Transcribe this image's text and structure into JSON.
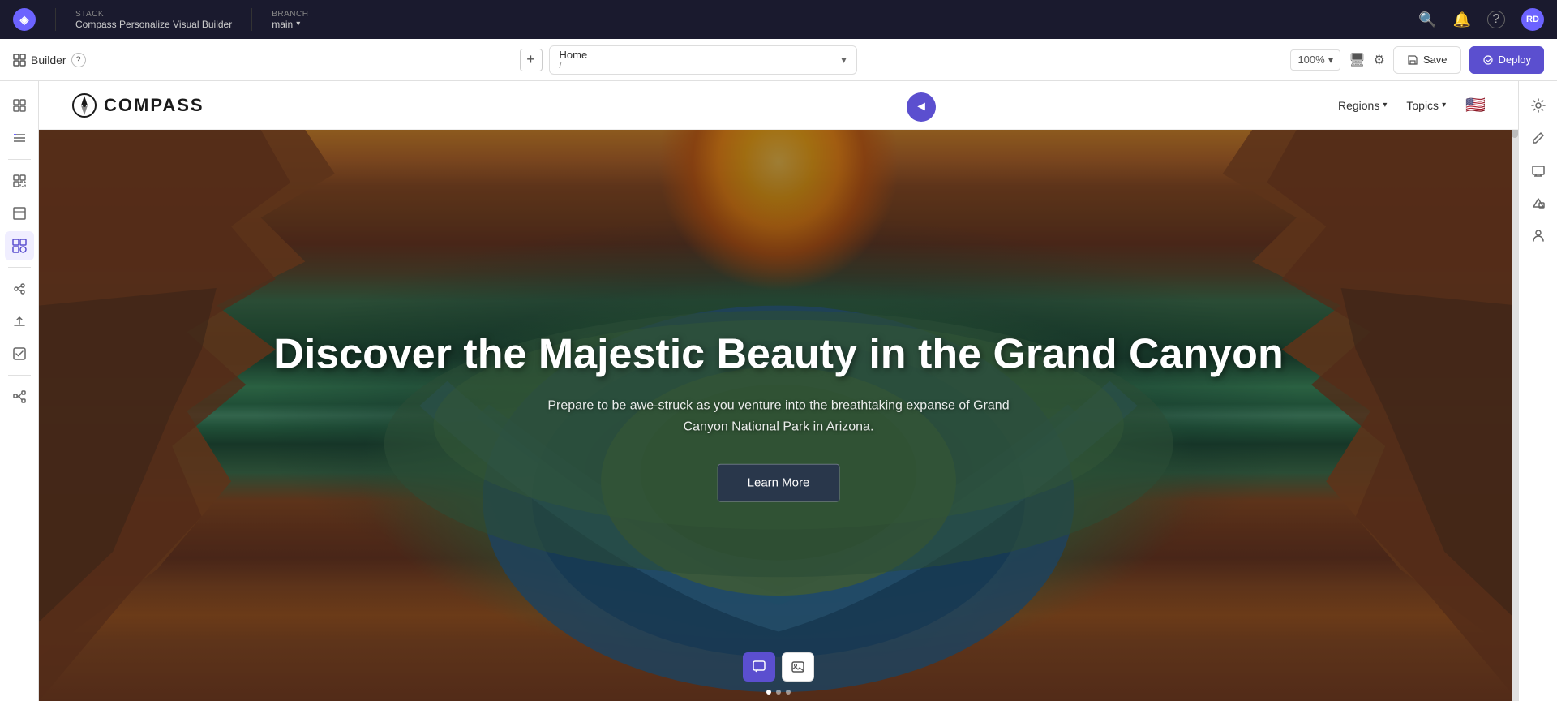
{
  "app": {
    "logo_symbol": "◈",
    "stack_label": "Stack",
    "stack_name": "Compass Personalize Visual Builder",
    "branch_label": "Branch",
    "branch_name": "main"
  },
  "topbar": {
    "search_icon": "🔍",
    "bell_icon": "🔔",
    "help_icon": "?",
    "avatar_text": "RD"
  },
  "builder_bar": {
    "builder_label": "Builder",
    "help_symbol": "?",
    "add_symbol": "+",
    "page_name": "Home",
    "page_path": "/",
    "zoom_level": "100%",
    "zoom_arrow": "▾",
    "save_label": "Save",
    "deploy_label": "Deploy"
  },
  "sidebar_left": {
    "icons": [
      {
        "name": "grid-icon",
        "symbol": "⊞",
        "active": false
      },
      {
        "name": "layers-icon",
        "symbol": "☰",
        "active": false
      },
      {
        "name": "components-icon",
        "symbol": "⊡",
        "active": false
      },
      {
        "name": "layers-panel-icon",
        "symbol": "◫",
        "active": false
      },
      {
        "name": "frames-icon",
        "symbol": "⬚",
        "active": true
      },
      {
        "name": "integrations-icon",
        "symbol": "⌗",
        "active": false
      },
      {
        "name": "upload-icon",
        "symbol": "↑",
        "active": false
      },
      {
        "name": "clipboard-icon",
        "symbol": "📋",
        "active": false
      },
      {
        "name": "flow-icon",
        "symbol": "⇄",
        "active": false
      }
    ]
  },
  "site_nav": {
    "logo_text": "COMPASS",
    "regions_label": "Regions",
    "topics_label": "Topics",
    "flag": "🇺🇸"
  },
  "hero": {
    "title": "Discover the Majestic Beauty in the Grand Canyon",
    "subtitle": "Prepare to be awe-struck as you venture into the breathtaking expanse of Grand Canyon National Park in Arizona.",
    "cta_label": "Learn More"
  },
  "right_sidebar": {
    "icons": [
      {
        "name": "settings-right-icon",
        "symbol": "⚙"
      },
      {
        "name": "edit-content-icon",
        "symbol": "✎"
      },
      {
        "name": "preview-icon",
        "symbol": "◫"
      },
      {
        "name": "shapes-icon",
        "symbol": "△□"
      },
      {
        "name": "user-icon",
        "symbol": "👤"
      }
    ]
  },
  "hero_toolbar": {
    "comment_btn": "💬",
    "image_btn": "🖼"
  }
}
